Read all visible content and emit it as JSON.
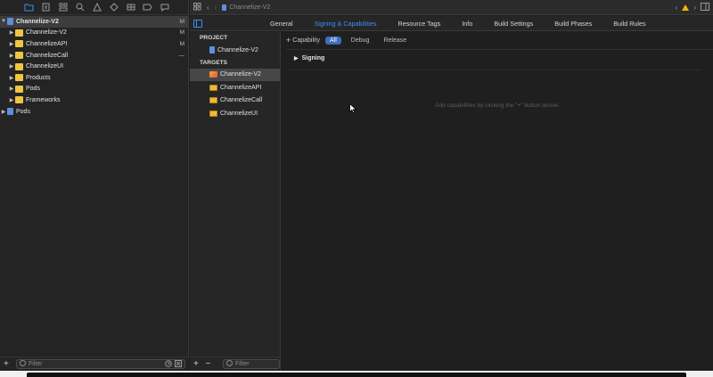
{
  "navigator": {
    "tree": [
      {
        "label": "Channelize-V2",
        "depth": 0,
        "expanded": true,
        "icon": "project-file-icon",
        "status": "M",
        "bold": true,
        "selected": true
      },
      {
        "label": "Channelize-V2",
        "depth": 1,
        "expanded": false,
        "icon": "folder-icon",
        "status": "M"
      },
      {
        "label": "ChannelizeAPI",
        "depth": 1,
        "expanded": false,
        "icon": "folder-icon",
        "status": "M"
      },
      {
        "label": "ChannelizeCall",
        "depth": 1,
        "expanded": false,
        "icon": "folder-icon",
        "status": "—"
      },
      {
        "label": "ChannelizeUI",
        "depth": 1,
        "expanded": false,
        "icon": "folder-icon",
        "status": ""
      },
      {
        "label": "Products",
        "depth": 1,
        "expanded": false,
        "icon": "folder-icon",
        "status": ""
      },
      {
        "label": "Pods",
        "depth": 1,
        "expanded": false,
        "icon": "folder-icon",
        "status": ""
      },
      {
        "label": "Frameworks",
        "depth": 1,
        "expanded": false,
        "icon": "folder-icon",
        "status": ""
      },
      {
        "label": "Pods",
        "depth": 0,
        "expanded": false,
        "icon": "project-file-icon",
        "status": ""
      }
    ],
    "filter_placeholder": "Filter"
  },
  "jumpbar": {
    "breadcrumb": "Channelize-V2"
  },
  "tabs": [
    {
      "label": "General",
      "active": false
    },
    {
      "label": "Signing & Capabilities",
      "active": true
    },
    {
      "label": "Resource Tags",
      "active": false
    },
    {
      "label": "Info",
      "active": false
    },
    {
      "label": "Build Settings",
      "active": false
    },
    {
      "label": "Build Phases",
      "active": false
    },
    {
      "label": "Build Rules",
      "active": false
    }
  ],
  "project_section": {
    "header": "PROJECT",
    "items": [
      {
        "label": "Channelize-V2",
        "icon": "project-file-icon"
      }
    ]
  },
  "targets_section": {
    "header": "TARGETS",
    "items": [
      {
        "label": "Channelize-V2",
        "icon": "app-target-icon",
        "selected": true
      },
      {
        "label": "ChannelizeAPI",
        "icon": "framework-icon",
        "selected": false
      },
      {
        "label": "ChannelizeCall",
        "icon": "framework-icon",
        "selected": false
      },
      {
        "label": "ChannelizeUI",
        "icon": "framework-icon",
        "selected": false
      }
    ],
    "filter_placeholder": "Filter"
  },
  "capabilities": {
    "add_label": "Capability",
    "segments": [
      {
        "label": "All",
        "active": true
      },
      {
        "label": "Debug",
        "active": false
      },
      {
        "label": "Release",
        "active": false
      }
    ],
    "signing_label": "Signing",
    "hint": "Add capabilities by clicking the \"+\" button above."
  },
  "colors": {
    "accent": "#3c8ef5",
    "folder": "#f0c640",
    "warning": "#f3b300"
  }
}
